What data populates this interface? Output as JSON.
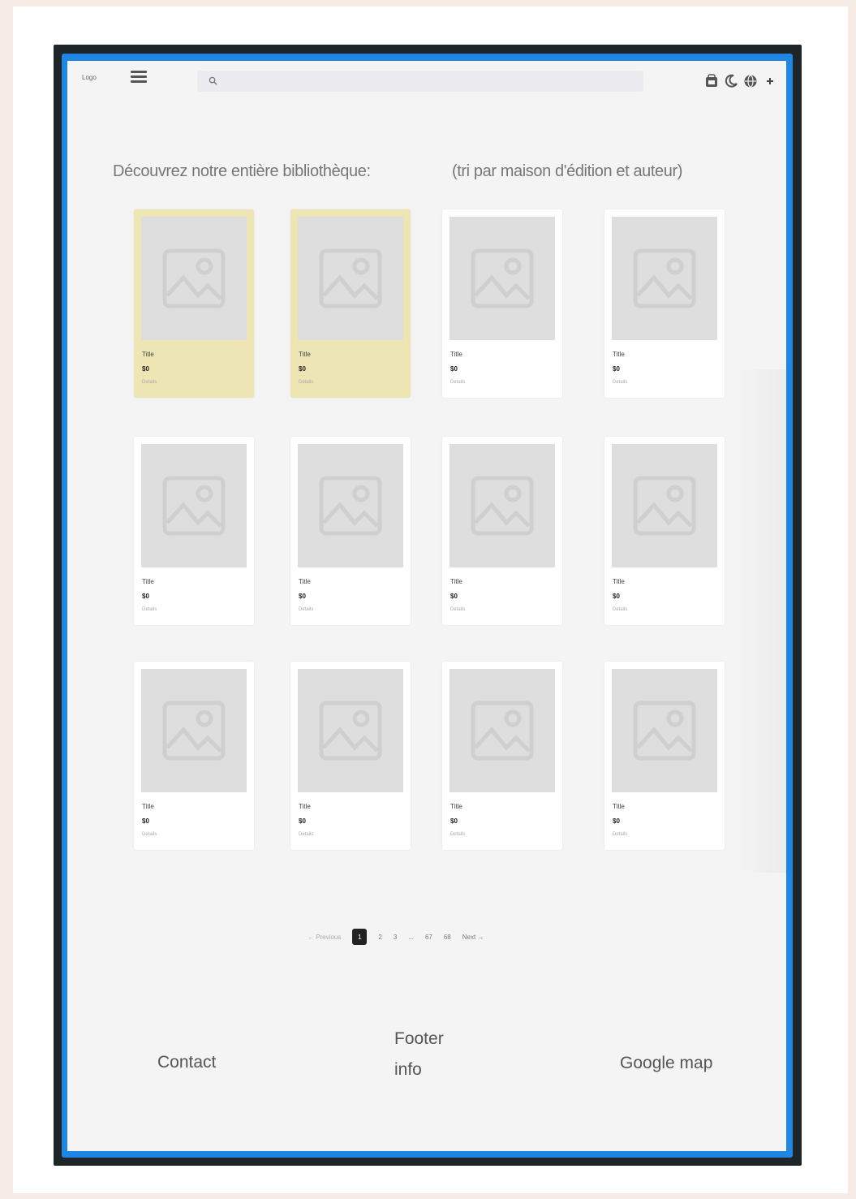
{
  "header": {
    "logo": "Logo",
    "search_placeholder": ""
  },
  "heading": {
    "title": "Découvrez notre entière bibliothèque:",
    "subtitle": "(tri par maison d'édition et auteur)"
  },
  "cards": [
    {
      "title": "Title",
      "price": "$0",
      "detail": "Details",
      "highlighted": true
    },
    {
      "title": "Title",
      "price": "$0",
      "detail": "Details",
      "highlighted": true
    },
    {
      "title": "Title",
      "price": "$0",
      "detail": "Details",
      "highlighted": false
    },
    {
      "title": "Title",
      "price": "$0",
      "detail": "Details",
      "highlighted": false
    },
    {
      "title": "Title",
      "price": "$0",
      "detail": "Details",
      "highlighted": false
    },
    {
      "title": "Title",
      "price": "$0",
      "detail": "Details",
      "highlighted": false
    },
    {
      "title": "Title",
      "price": "$0",
      "detail": "Details",
      "highlighted": false
    },
    {
      "title": "Title",
      "price": "$0",
      "detail": "Details",
      "highlighted": false
    },
    {
      "title": "Title",
      "price": "$0",
      "detail": "Details",
      "highlighted": false
    },
    {
      "title": "Title",
      "price": "$0",
      "detail": "Details",
      "highlighted": false
    },
    {
      "title": "Title",
      "price": "$0",
      "detail": "Details",
      "highlighted": false
    },
    {
      "title": "Title",
      "price": "$0",
      "detail": "Details",
      "highlighted": false
    }
  ],
  "pagination": {
    "previous": "← Previous",
    "pages": [
      "1",
      "2",
      "3",
      "...",
      "67",
      "68"
    ],
    "active_page": "1",
    "next": "Next →"
  },
  "footer": {
    "contact": "Contact",
    "info": "Footer info",
    "map": "Google map"
  },
  "colors": {
    "highlight": "#ede5b3",
    "screen_border": "#1f86e4",
    "device": "#1d2528"
  }
}
